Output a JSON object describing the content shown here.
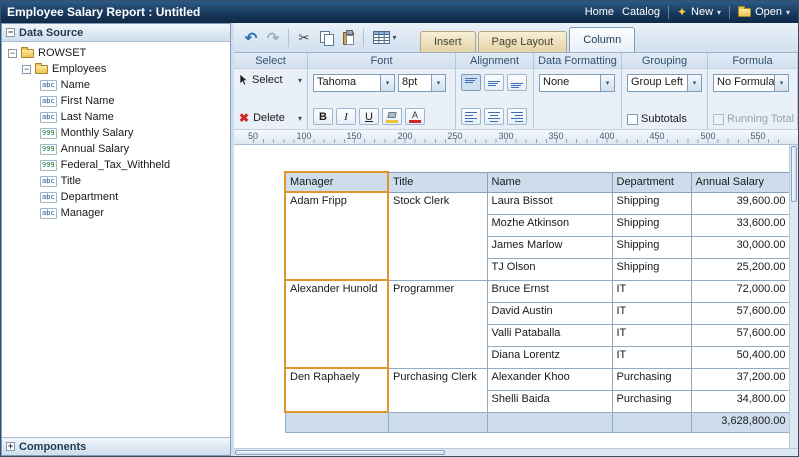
{
  "icons": {
    "caret_down": "▾",
    "undo": "↶",
    "redo": "↷",
    "cut": "✂",
    "delete_x": "✖",
    "new_sparkle": "✦",
    "expander_collapse": "−",
    "expander_expand": "+",
    "bucket_note": "fill-color-bucket",
    "font_color_letter": "A"
  },
  "titlebar": {
    "title": "Employee Salary Report : Untitled",
    "home": "Home",
    "catalog": "Catalog",
    "new_label": "New",
    "open_label": "Open"
  },
  "sidebar": {
    "data_source_label": "Data Source",
    "components_label": "Components",
    "tree": {
      "root": "ROWSET",
      "group": "Employees",
      "fields": [
        {
          "type": "abc",
          "label": "Name"
        },
        {
          "type": "abc",
          "label": "First Name"
        },
        {
          "type": "abc",
          "label": "Last Name"
        },
        {
          "type": "999",
          "label": "Monthly Salary"
        },
        {
          "type": "999",
          "label": "Annual Salary"
        },
        {
          "type": "999",
          "label": "Federal_Tax_Withheld"
        },
        {
          "type": "abc",
          "label": "Title"
        },
        {
          "type": "abc",
          "label": "Department"
        },
        {
          "type": "abc",
          "label": "Manager"
        }
      ]
    }
  },
  "tabs": {
    "insert": "Insert",
    "page_layout": "Page Layout",
    "column": "Column"
  },
  "ribbon": {
    "group_labels": {
      "select": "Select",
      "font": "Font",
      "alignment": "Alignment",
      "data_formatting": "Data Formatting",
      "grouping": "Grouping",
      "formula": "Formula"
    },
    "select": {
      "select_label": "Select",
      "delete_label": "Delete"
    },
    "font": {
      "family": "Tahoma",
      "size": "8pt",
      "bold": "B",
      "italic": "I",
      "underline": "U"
    },
    "data_formatting": {
      "value": "None"
    },
    "grouping": {
      "value": "Group Left",
      "subtotals_label": "Subtotals"
    },
    "formula": {
      "value": "No Formula",
      "running_total_label": "Running Total"
    }
  },
  "ruler": {
    "ticks": [
      "50",
      "100",
      "150",
      "200",
      "250",
      "300",
      "350",
      "400",
      "450",
      "500",
      "550"
    ]
  },
  "report_table": {
    "columns": [
      "Manager",
      "Title",
      "Name",
      "Department",
      "Annual Salary"
    ],
    "groups": [
      {
        "manager": "Adam Fripp",
        "title": "Stock Clerk",
        "rows": [
          {
            "name": "Laura Bissot",
            "department": "Shipping",
            "salary": "39,600.00"
          },
          {
            "name": "Mozhe Atkinson",
            "department": "Shipping",
            "salary": "33,600.00"
          },
          {
            "name": "James Marlow",
            "department": "Shipping",
            "salary": "30,000.00"
          },
          {
            "name": "TJ Olson",
            "department": "Shipping",
            "salary": "25,200.00"
          }
        ]
      },
      {
        "manager": "Alexander Hunold",
        "title": "Programmer",
        "rows": [
          {
            "name": "Bruce Ernst",
            "department": "IT",
            "salary": "72,000.00"
          },
          {
            "name": "David Austin",
            "department": "IT",
            "salary": "57,600.00"
          },
          {
            "name": "Valli Pataballa",
            "department": "IT",
            "salary": "57,600.00"
          },
          {
            "name": "Diana Lorentz",
            "department": "IT",
            "salary": "50,400.00"
          }
        ]
      },
      {
        "manager": "Den Raphaely",
        "title": "Purchasing Clerk",
        "rows": [
          {
            "name": "Alexander Khoo",
            "department": "Purchasing",
            "salary": "37,200.00"
          },
          {
            "name": "Shelli Baida",
            "department": "Purchasing",
            "salary": "34,800.00"
          }
        ]
      }
    ],
    "grand_total": "3,628,800.00"
  },
  "colors": {
    "selection_orange": "#e0962c",
    "table_header_blue": "#cdddeb",
    "titlebar_navy": "#1c3e63",
    "tab_inactive_tan": "#e5d3a6"
  }
}
